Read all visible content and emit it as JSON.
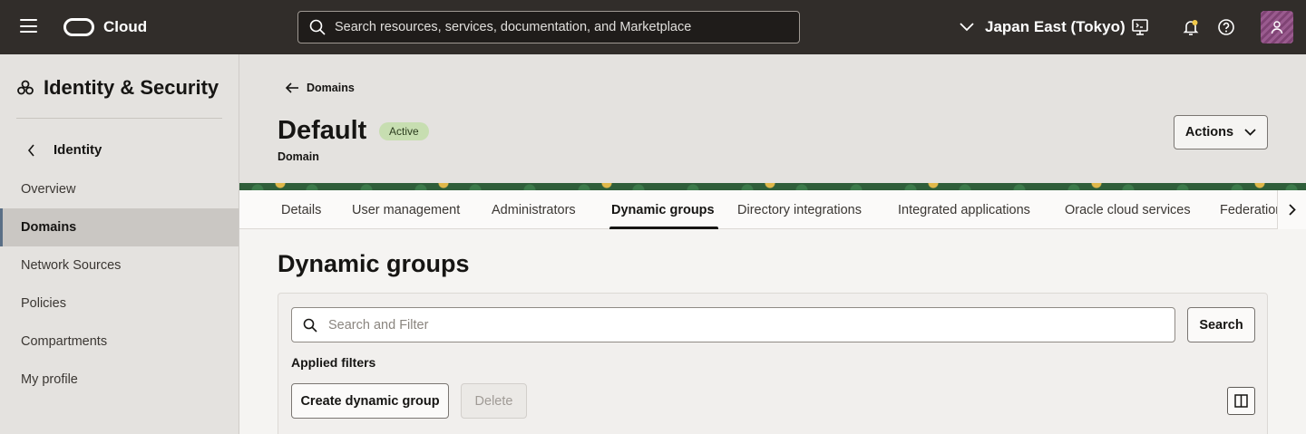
{
  "topbar": {
    "brand": "Cloud",
    "search_placeholder": "Search resources, services, documentation, and Marketplace",
    "region": "Japan East (Tokyo)"
  },
  "sidebar": {
    "title": "Identity & Security",
    "back_label": "Identity",
    "items": [
      {
        "label": "Overview",
        "active": false
      },
      {
        "label": "Domains",
        "active": true
      },
      {
        "label": "Network Sources",
        "active": false
      },
      {
        "label": "Policies",
        "active": false
      },
      {
        "label": "Compartments",
        "active": false
      },
      {
        "label": "My profile",
        "active": false
      }
    ]
  },
  "header": {
    "breadcrumb": "Domains",
    "title": "Default",
    "status": "Active",
    "subtitle": "Domain",
    "actions_label": "Actions"
  },
  "tabs": [
    {
      "label": "Details"
    },
    {
      "label": "User management"
    },
    {
      "label": "Administrators"
    },
    {
      "label": "Dynamic groups",
      "active": true
    },
    {
      "label": "Directory integrations"
    },
    {
      "label": "Integrated applications"
    },
    {
      "label": "Oracle cloud services"
    },
    {
      "label": "Federation"
    }
  ],
  "main": {
    "title": "Dynamic groups",
    "filter_placeholder": "Search and Filter",
    "search_button": "Search",
    "applied_filters": "Applied filters",
    "create_button": "Create dynamic group",
    "delete_button": "Delete"
  },
  "colors": {
    "topbar_bg": "#312d2a",
    "sidebar_bg": "#e4e2df",
    "badge_bg": "#c7deb1",
    "active_nav_bg": "#cac7c3"
  }
}
